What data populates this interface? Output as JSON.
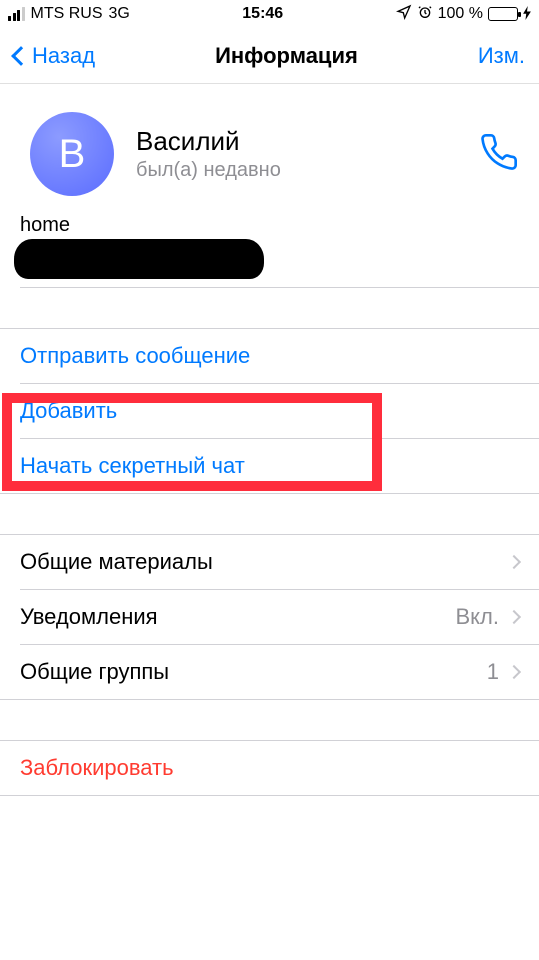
{
  "status": {
    "carrier": "MTS RUS",
    "network": "3G",
    "time": "15:46",
    "battery_text": "100 %"
  },
  "nav": {
    "back": "Назад",
    "title": "Информация",
    "edit": "Изм."
  },
  "profile": {
    "avatar_letter": "В",
    "name": "Василий",
    "status": "был(а) недавно"
  },
  "phone": {
    "label": "home"
  },
  "actions": {
    "send_message": "Отправить сообщение",
    "add": "Добавить",
    "secret_chat": "Начать секретный чат"
  },
  "settings": {
    "shared_media": "Общие материалы",
    "notifications": "Уведомления",
    "notifications_value": "Вкл.",
    "shared_groups": "Общие группы",
    "shared_groups_value": "1"
  },
  "block": {
    "label": "Заблокировать"
  }
}
